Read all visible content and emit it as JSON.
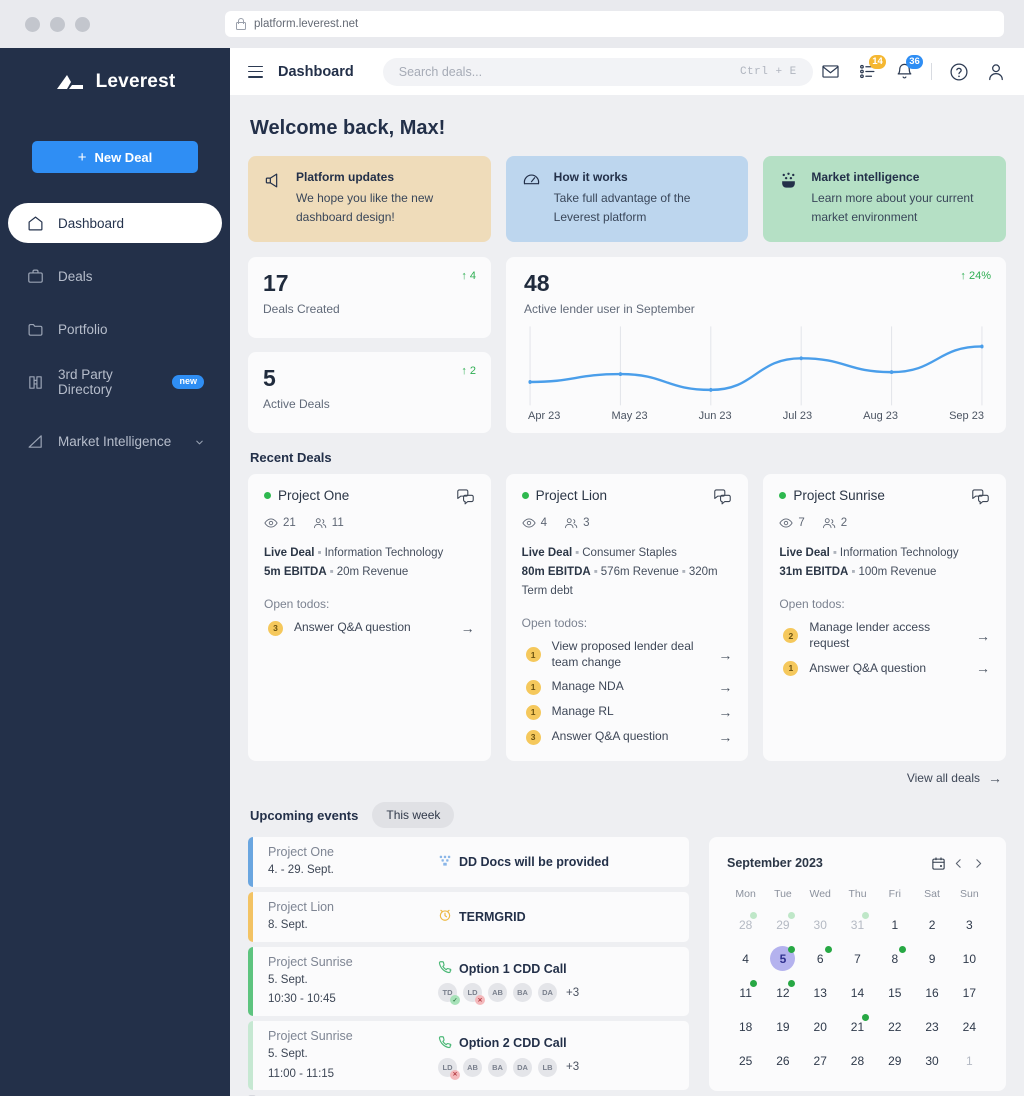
{
  "browser": {
    "url": "platform.leverest.net"
  },
  "sidebar": {
    "brand": "Leverest",
    "new_deal_label": "New Deal",
    "items": [
      {
        "label": "Dashboard",
        "icon": "home-icon",
        "active": true
      },
      {
        "label": "Deals",
        "icon": "briefcase-icon",
        "active": false
      },
      {
        "label": "Portfolio",
        "icon": "folder-icon",
        "active": false
      },
      {
        "label": "3rd Party Directory",
        "icon": "book-icon",
        "active": false,
        "badge": "new"
      },
      {
        "label": "Market Intelligence",
        "icon": "bar-chart-icon",
        "active": false,
        "chevron": true
      }
    ]
  },
  "topbar": {
    "page_title": "Dashboard",
    "search_placeholder": "Search deals...",
    "search_value": "",
    "shortcut": "Ctrl + E",
    "mail_icon": "envelope-icon",
    "tasks_count": "14",
    "notifications_count": "36",
    "help_label": "?"
  },
  "welcome": "Welcome back, Max!",
  "promos": [
    {
      "icon": "megaphone-icon",
      "title": "Platform updates",
      "body": "We hope you like the new dashboard design!",
      "color": "#efdcba"
    },
    {
      "icon": "speedometer-icon",
      "title": "How it works",
      "body": "Take full advantage of the Leverest platform",
      "color": "#bdd6ee"
    },
    {
      "icon": "crowd-icon",
      "title": "Market intelligence",
      "body": "Learn more about your current market environment",
      "color": "#b5e0c5"
    }
  ],
  "stats": [
    {
      "value": "17",
      "label": "Deals Created",
      "delta": "↑ 4"
    },
    {
      "value": "5",
      "label": "Active Deals",
      "delta": "↑ 2"
    }
  ],
  "chart_card": {
    "value": "48",
    "label": "Active lender user in September",
    "delta": "↑ 24%"
  },
  "chart_data": {
    "type": "line",
    "title": "Active lender user in September",
    "categories": [
      "Apr 23",
      "May 23",
      "Jun 23",
      "Jul 23",
      "Aug 23",
      "Sep 23"
    ],
    "values": [
      30,
      34,
      26,
      42,
      35,
      48
    ],
    "series": [
      {
        "name": "Active lender users",
        "values": [
          30,
          34,
          26,
          42,
          35,
          48
        ]
      }
    ],
    "xlabel": "",
    "ylabel": "",
    "ylim": [
      20,
      52
    ],
    "grid": "vertical-ticks-only",
    "legend": "none",
    "line_color": "#4a9eea"
  },
  "recent_deals": {
    "heading": "Recent Deals",
    "view_all": "View all deals",
    "cards": [
      {
        "name": "Project One",
        "status": "live",
        "views": "21",
        "members": "11",
        "tags": [
          "Live Deal",
          "Information Technology"
        ],
        "metrics": [
          "5m EBITDA",
          "20m Revenue"
        ],
        "todos_label": "Open todos:",
        "todos": [
          {
            "count": "3",
            "text": "Answer Q&A question"
          }
        ]
      },
      {
        "name": "Project Lion",
        "status": "live",
        "views": "4",
        "members": "3",
        "tags": [
          "Live Deal",
          "Consumer Staples"
        ],
        "metrics": [
          "80m EBITDA",
          "576m Revenue",
          "320m Term debt"
        ],
        "todos_label": "Open todos:",
        "todos": [
          {
            "count": "1",
            "text": "View proposed lender deal team change"
          },
          {
            "count": "1",
            "text": "Manage NDA"
          },
          {
            "count": "1",
            "text": "Manage RL"
          },
          {
            "count": "3",
            "text": "Answer Q&A question"
          }
        ]
      },
      {
        "name": "Project Sunrise",
        "status": "live",
        "views": "7",
        "members": "2",
        "tags": [
          "Live Deal",
          "Information Technology"
        ],
        "metrics": [
          "31m EBITDA",
          "100m Revenue"
        ],
        "todos_label": "Open todos:",
        "todos": [
          {
            "count": "2",
            "text": "Manage lender access request"
          },
          {
            "count": "1",
            "text": "Answer Q&A question"
          }
        ]
      }
    ]
  },
  "upcoming": {
    "heading": "Upcoming events",
    "filter": "This week",
    "events": [
      {
        "project": "Project One",
        "date": "4. - 29. Sept.",
        "time": "",
        "title": "DD Docs will be provided",
        "icon": "docs-icon",
        "accent": "#6aa6e0",
        "avatars": []
      },
      {
        "project": "Project Lion",
        "date": "8. Sept.",
        "time": "",
        "title": "TERMGRID",
        "icon": "clock-icon",
        "accent": "#f3c364",
        "avatars": []
      },
      {
        "project": "Project Sunrise",
        "date": "5. Sept.",
        "time": "10:30 - 10:45",
        "title": "Option 1 CDD Call",
        "icon": "phone-icon",
        "accent": "#5ec47f",
        "avatars": [
          {
            "initials": "TD",
            "mark": "ok"
          },
          {
            "initials": "LD",
            "mark": "no"
          },
          {
            "initials": "AB",
            "mark": ""
          },
          {
            "initials": "BA",
            "mark": ""
          },
          {
            "initials": "DA",
            "mark": ""
          }
        ],
        "more": "+3"
      },
      {
        "project": "Project Sunrise",
        "date": "5. Sept.",
        "time": "11:00 - 11:15",
        "title": "Option 2 CDD Call",
        "icon": "phone-icon",
        "accent": "#c6e8d2",
        "avatars": [
          {
            "initials": "LD",
            "mark": "no"
          },
          {
            "initials": "AB",
            "mark": ""
          },
          {
            "initials": "BA",
            "mark": ""
          },
          {
            "initials": "DA",
            "mark": ""
          },
          {
            "initials": "LB",
            "mark": ""
          }
        ],
        "more": "+3"
      }
    ]
  },
  "calendar": {
    "title": "September 2023",
    "dow": [
      "Mon",
      "Tue",
      "Wed",
      "Thu",
      "Fri",
      "Sat",
      "Sun"
    ],
    "selected": 5,
    "cells": [
      {
        "d": "28",
        "muted": true,
        "dot": "faint"
      },
      {
        "d": "29",
        "muted": true,
        "dot": "faint"
      },
      {
        "d": "30",
        "muted": true,
        "dot": ""
      },
      {
        "d": "31",
        "muted": true,
        "dot": "faint"
      },
      {
        "d": "1",
        "muted": false,
        "dot": ""
      },
      {
        "d": "2",
        "muted": false,
        "dot": ""
      },
      {
        "d": "3",
        "muted": false,
        "dot": ""
      },
      {
        "d": "4",
        "muted": false,
        "dot": ""
      },
      {
        "d": "5",
        "muted": false,
        "dot": "solid",
        "sel": true
      },
      {
        "d": "6",
        "muted": false,
        "dot": "solid"
      },
      {
        "d": "7",
        "muted": false,
        "dot": ""
      },
      {
        "d": "8",
        "muted": false,
        "dot": "solid"
      },
      {
        "d": "9",
        "muted": false,
        "dot": ""
      },
      {
        "d": "10",
        "muted": false,
        "dot": ""
      },
      {
        "d": "11",
        "muted": false,
        "dot": "solid"
      },
      {
        "d": "12",
        "muted": false,
        "dot": "solid"
      },
      {
        "d": "13",
        "muted": false,
        "dot": ""
      },
      {
        "d": "14",
        "muted": false,
        "dot": ""
      },
      {
        "d": "15",
        "muted": false,
        "dot": ""
      },
      {
        "d": "16",
        "muted": false,
        "dot": ""
      },
      {
        "d": "17",
        "muted": false,
        "dot": ""
      },
      {
        "d": "18",
        "muted": false,
        "dot": ""
      },
      {
        "d": "19",
        "muted": false,
        "dot": ""
      },
      {
        "d": "20",
        "muted": false,
        "dot": ""
      },
      {
        "d": "21",
        "muted": false,
        "dot": "solid"
      },
      {
        "d": "22",
        "muted": false,
        "dot": ""
      },
      {
        "d": "23",
        "muted": false,
        "dot": ""
      },
      {
        "d": "24",
        "muted": false,
        "dot": ""
      },
      {
        "d": "25",
        "muted": false,
        "dot": ""
      },
      {
        "d": "26",
        "muted": false,
        "dot": ""
      },
      {
        "d": "27",
        "muted": false,
        "dot": ""
      },
      {
        "d": "28",
        "muted": false,
        "dot": ""
      },
      {
        "d": "29",
        "muted": false,
        "dot": ""
      },
      {
        "d": "30",
        "muted": false,
        "dot": ""
      },
      {
        "d": "1",
        "muted": true,
        "dot": ""
      }
    ]
  }
}
